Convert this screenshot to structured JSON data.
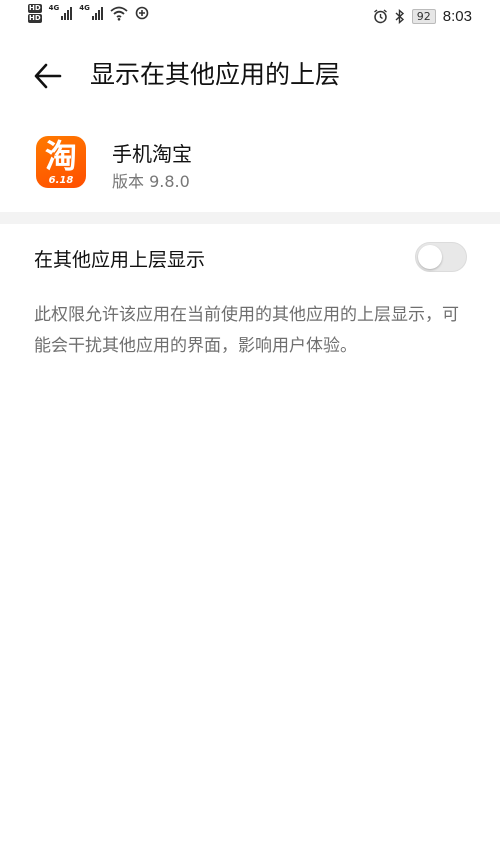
{
  "status_bar": {
    "hd_1": "HD",
    "hd_2": "HD",
    "network_1": "4G",
    "network_2": "4G",
    "battery": "92",
    "time": "8:03",
    "icons": [
      "hd-icon",
      "signal-icon",
      "wifi-icon",
      "data-saver-icon",
      "alarm-icon",
      "bluetooth-icon",
      "battery-icon"
    ]
  },
  "header": {
    "title": "显示在其他应用的上层"
  },
  "app": {
    "icon_glyph": "淘",
    "icon_sub": "6.18",
    "name": "手机淘宝",
    "version": "版本 9.8.0",
    "accent": "#ff5a00"
  },
  "setting": {
    "label": "在其他应用上层显示",
    "enabled": false
  },
  "description": "此权限允许该应用在当前使用的其他应用的上层显示，可能会干扰其他应用的界面，影响用户体验。"
}
